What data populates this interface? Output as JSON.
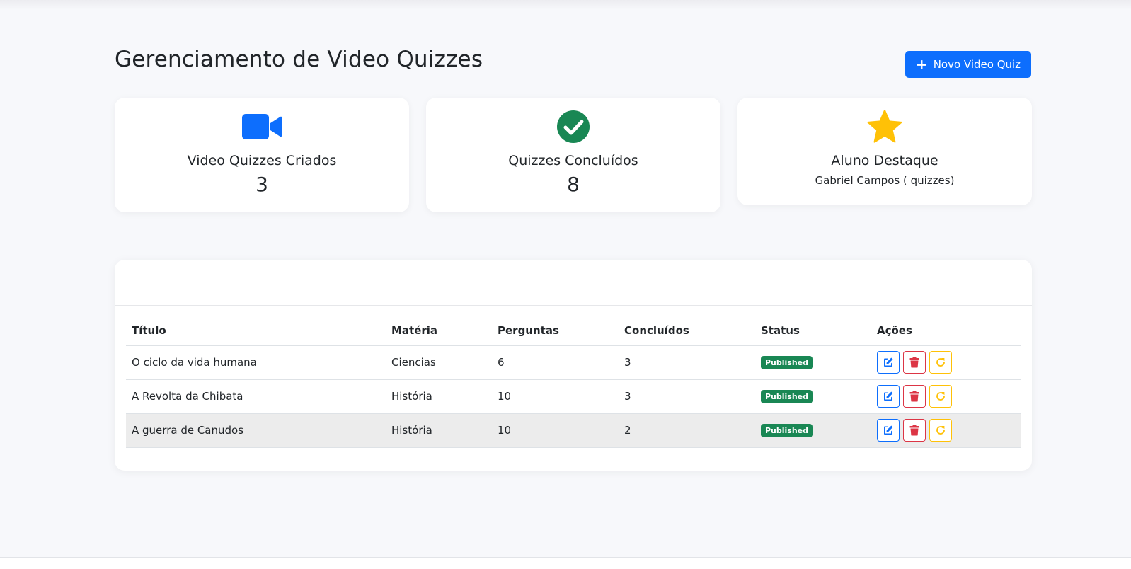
{
  "header": {
    "title": "Gerenciamento de Video Quizzes",
    "new_button_label": "Novo Video Quiz"
  },
  "stats": [
    {
      "icon": "video-camera-icon",
      "label": "Video Quizzes Criados",
      "value": "3",
      "color": "#0d6efd"
    },
    {
      "icon": "check-circle-icon",
      "label": "Quizzes Concluídos",
      "value": "8",
      "color": "#198754"
    },
    {
      "icon": "star-icon",
      "label": "Aluno Destaque",
      "value": "Gabriel Campos ( quizzes)",
      "color": "#ffc107"
    }
  ],
  "table": {
    "columns": [
      "Título",
      "Matéria",
      "Perguntas",
      "Concluídos",
      "Status",
      "Ações"
    ],
    "rows": [
      {
        "title": "O ciclo da vida humana",
        "subject": "Ciencias",
        "questions": "6",
        "completed": "3",
        "status": "Published"
      },
      {
        "title": "A Revolta da Chibata",
        "subject": "História",
        "questions": "10",
        "completed": "3",
        "status": "Published"
      },
      {
        "title": "A guerra de Canudos",
        "subject": "História",
        "questions": "10",
        "completed": "2",
        "status": "Published"
      }
    ]
  },
  "colors": {
    "primary": "#0d6efd",
    "success": "#198754",
    "danger": "#dc3545",
    "warning": "#ffc107"
  }
}
